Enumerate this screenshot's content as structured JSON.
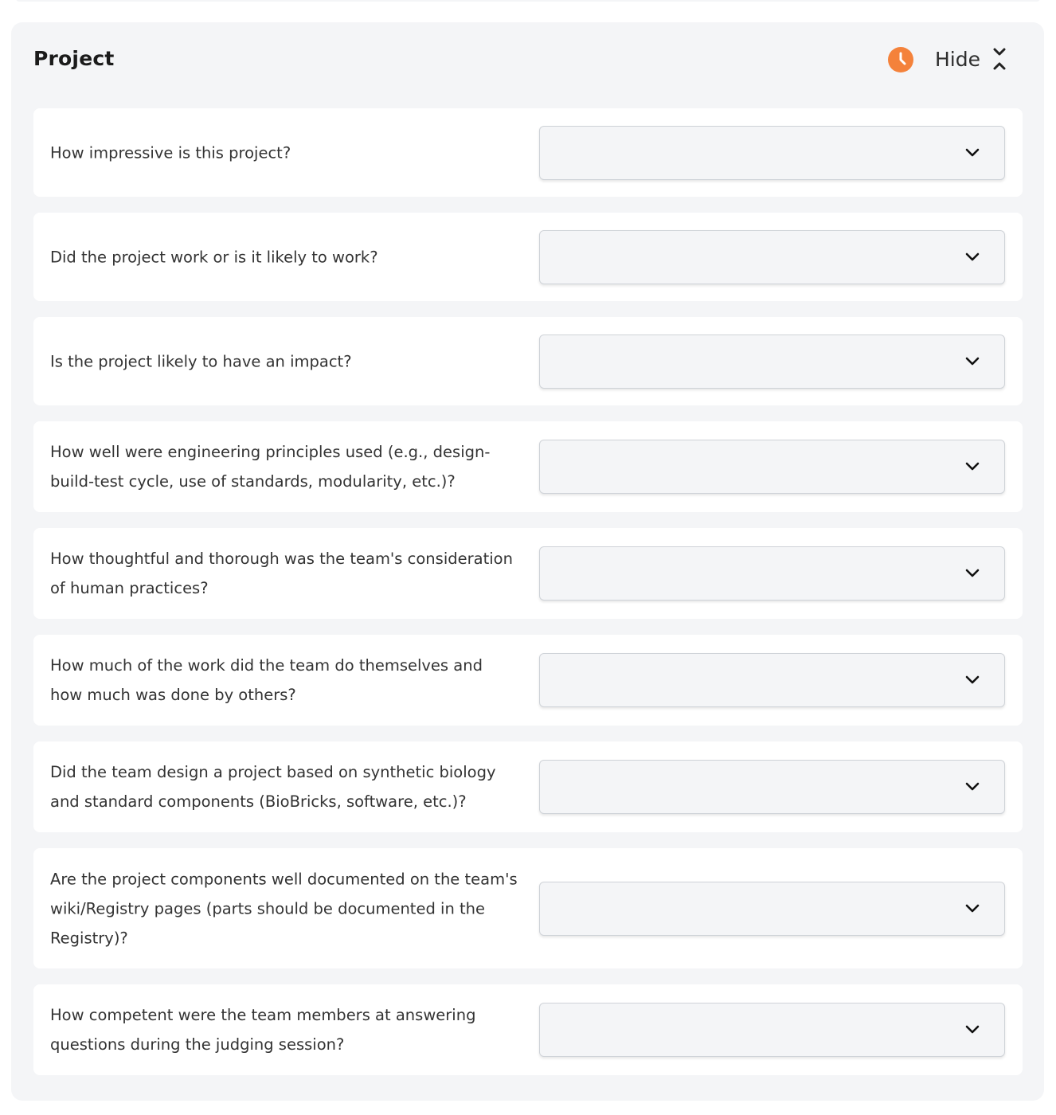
{
  "section": {
    "title": "Project",
    "status_icon": "clock-icon",
    "status_color": "#f4823b",
    "toggle_label": "Hide",
    "toggle_icon": "collapse-arrows-icon"
  },
  "questions": [
    {
      "text": "How impressive is this project?",
      "selected": ""
    },
    {
      "text": "Did the project work or is it likely to work?",
      "selected": ""
    },
    {
      "text": "Is the project likely to have an impact?",
      "selected": ""
    },
    {
      "text": "How well were engineering principles used (e.g., design-build-test cycle, use of standards, modularity, etc.)?",
      "selected": ""
    },
    {
      "text": "How thoughtful and thorough was the team's consideration of human practices?",
      "selected": ""
    },
    {
      "text": "How much of the work did the team do themselves and how much was done by others?",
      "selected": ""
    },
    {
      "text": "Did the team design a project based on synthetic biology and standard components (BioBricks, software, etc.)?",
      "selected": ""
    },
    {
      "text": "Are the project components well documented on the team's wiki/Registry pages (parts should be documented in the Registry)?",
      "selected": ""
    },
    {
      "text": "How competent were the team members at answering questions during the judging session?",
      "selected": ""
    }
  ],
  "colors": {
    "panel_background": "#f4f5f7",
    "card_background": "#ffffff",
    "accent": "#f4823b"
  }
}
